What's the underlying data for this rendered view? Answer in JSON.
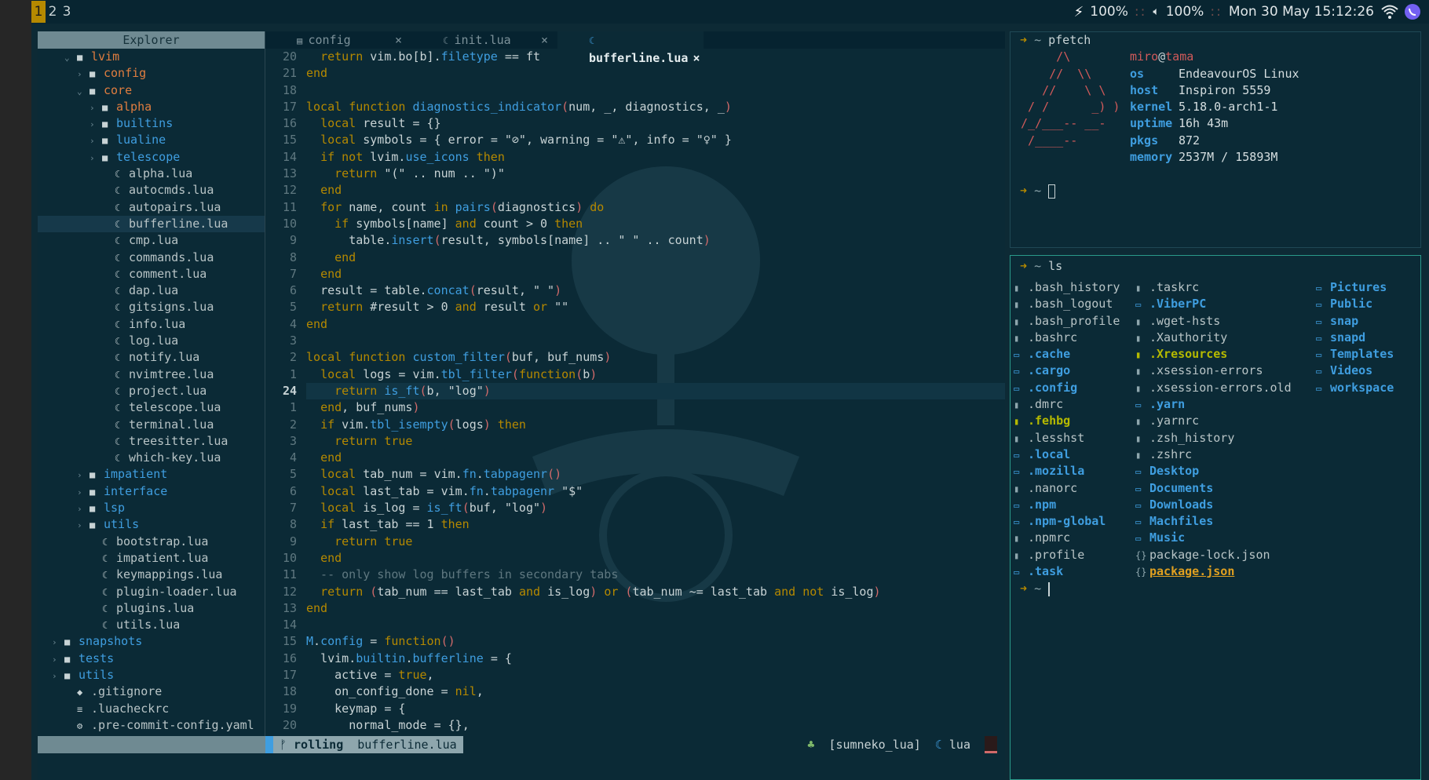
{
  "topbar": {
    "workspaces": [
      "1",
      "2",
      "3"
    ],
    "active_workspace": "1",
    "battery": "100%",
    "volume": "100%",
    "datetime": "Mon 30 May 15:12:26",
    "separator": "::"
  },
  "explorer": {
    "title": "Explorer",
    "items": [
      {
        "depth": 1,
        "arrow": "⌄",
        "type": "dir",
        "name": "lvim",
        "color": "orange"
      },
      {
        "depth": 2,
        "arrow": "›",
        "type": "dir",
        "name": "config",
        "color": "orange"
      },
      {
        "depth": 2,
        "arrow": "⌄",
        "type": "dir",
        "name": "core",
        "color": "orange"
      },
      {
        "depth": 3,
        "arrow": "›",
        "type": "dir",
        "name": "alpha",
        "color": "orange"
      },
      {
        "depth": 3,
        "arrow": "›",
        "type": "dir",
        "name": "builtins",
        "color": "blue"
      },
      {
        "depth": 3,
        "arrow": "›",
        "type": "dir",
        "name": "lualine",
        "color": "blue"
      },
      {
        "depth": 3,
        "arrow": "›",
        "type": "dir",
        "name": "telescope",
        "color": "blue"
      },
      {
        "depth": 4,
        "arrow": "",
        "type": "lua",
        "name": "alpha.lua"
      },
      {
        "depth": 4,
        "arrow": "",
        "type": "lua",
        "name": "autocmds.lua"
      },
      {
        "depth": 4,
        "arrow": "",
        "type": "lua",
        "name": "autopairs.lua"
      },
      {
        "depth": 4,
        "arrow": "",
        "type": "lua",
        "name": "bufferline.lua",
        "selected": true
      },
      {
        "depth": 4,
        "arrow": "",
        "type": "lua",
        "name": "cmp.lua"
      },
      {
        "depth": 4,
        "arrow": "",
        "type": "lua",
        "name": "commands.lua"
      },
      {
        "depth": 4,
        "arrow": "",
        "type": "lua",
        "name": "comment.lua"
      },
      {
        "depth": 4,
        "arrow": "",
        "type": "lua",
        "name": "dap.lua"
      },
      {
        "depth": 4,
        "arrow": "",
        "type": "lua",
        "name": "gitsigns.lua"
      },
      {
        "depth": 4,
        "arrow": "",
        "type": "lua",
        "name": "info.lua"
      },
      {
        "depth": 4,
        "arrow": "",
        "type": "lua",
        "name": "log.lua"
      },
      {
        "depth": 4,
        "arrow": "",
        "type": "lua",
        "name": "notify.lua"
      },
      {
        "depth": 4,
        "arrow": "",
        "type": "lua",
        "name": "nvimtree.lua"
      },
      {
        "depth": 4,
        "arrow": "",
        "type": "lua",
        "name": "project.lua"
      },
      {
        "depth": 4,
        "arrow": "",
        "type": "lua",
        "name": "telescope.lua"
      },
      {
        "depth": 4,
        "arrow": "",
        "type": "lua",
        "name": "terminal.lua"
      },
      {
        "depth": 4,
        "arrow": "",
        "type": "lua",
        "name": "treesitter.lua"
      },
      {
        "depth": 4,
        "arrow": "",
        "type": "lua",
        "name": "which-key.lua"
      },
      {
        "depth": 2,
        "arrow": "›",
        "type": "dir",
        "name": "impatient",
        "color": "blue"
      },
      {
        "depth": 2,
        "arrow": "›",
        "type": "dir",
        "name": "interface",
        "color": "blue"
      },
      {
        "depth": 2,
        "arrow": "›",
        "type": "dir",
        "name": "lsp",
        "color": "blue"
      },
      {
        "depth": 2,
        "arrow": "›",
        "type": "dir",
        "name": "utils",
        "color": "blue"
      },
      {
        "depth": 3,
        "arrow": "",
        "type": "lua",
        "name": "bootstrap.lua"
      },
      {
        "depth": 3,
        "arrow": "",
        "type": "lua",
        "name": "impatient.lua"
      },
      {
        "depth": 3,
        "arrow": "",
        "type": "lua",
        "name": "keymappings.lua"
      },
      {
        "depth": 3,
        "arrow": "",
        "type": "lua",
        "name": "plugin-loader.lua"
      },
      {
        "depth": 3,
        "arrow": "",
        "type": "lua",
        "name": "plugins.lua"
      },
      {
        "depth": 3,
        "arrow": "",
        "type": "lua",
        "name": "utils.lua"
      },
      {
        "depth": 0,
        "arrow": "›",
        "type": "dir",
        "name": "snapshots",
        "color": "blue"
      },
      {
        "depth": 0,
        "arrow": "›",
        "type": "dir",
        "name": "tests",
        "color": "blue"
      },
      {
        "depth": 0,
        "arrow": "›",
        "type": "dir",
        "name": "utils",
        "color": "blue"
      },
      {
        "depth": 1,
        "arrow": "",
        "type": "git",
        "name": ".gitignore"
      },
      {
        "depth": 1,
        "arrow": "",
        "type": "text",
        "name": ".luacheckrc"
      },
      {
        "depth": 1,
        "arrow": "",
        "type": "gear",
        "name": ".pre-commit-config.yaml"
      }
    ]
  },
  "tabs": [
    {
      "label": "config",
      "icon": "file",
      "close": "×",
      "active": false
    },
    {
      "label": "init.lua",
      "icon": "lua",
      "close": "×",
      "active": false
    },
    {
      "label": "bufferline.lua",
      "icon": "lua",
      "close": "×",
      "active": true
    }
  ],
  "editor": {
    "line_numbers": [
      "20",
      "21",
      "18",
      "17",
      "16",
      "15",
      "14",
      "13",
      "12",
      "11",
      "10",
      "9",
      "8",
      "7",
      "6",
      "5",
      "4",
      "3",
      "2",
      "1",
      "24",
      "1",
      "2",
      "3",
      "4",
      "5",
      "6",
      "7",
      "8",
      "9",
      "10",
      "11",
      "12",
      "13",
      "14",
      "15",
      "16",
      "17",
      "18",
      "19",
      "20"
    ],
    "current_line_index": 20,
    "lines": [
      "  return vim.bo[b].filetype == ft",
      "end",
      "",
      "local function diagnostics_indicator(num, _, diagnostics, _)",
      "  local result = {}",
      "  local symbols = { error = \"⊘\", warning = \"⚠\", info = \"♀\" }",
      "  if not lvim.use_icons then",
      "    return \"(\" .. num .. \")\"",
      "  end",
      "  for name, count in pairs(diagnostics) do",
      "    if symbols[name] and count > 0 then",
      "      table.insert(result, symbols[name] .. \" \" .. count)",
      "    end",
      "  end",
      "  result = table.concat(result, \" \")",
      "  return #result > 0 and result or \"\"",
      "end",
      "",
      "local function custom_filter(buf, buf_nums)",
      "  local logs = vim.tbl_filter(function(b)",
      "    return is_ft(b, \"log\")",
      "  end, buf_nums)",
      "  if vim.tbl_isempty(logs) then",
      "    return true",
      "  end",
      "  local tab_num = vim.fn.tabpagenr()",
      "  local last_tab = vim.fn.tabpagenr \"$\"",
      "  local is_log = is_ft(buf, \"log\")",
      "  if last_tab == 1 then",
      "    return true",
      "  end",
      "  -- only show log buffers in secondary tabs",
      "  return (tab_num == last_tab and is_log) or (tab_num ~= last_tab and not is_log)",
      "end",
      "",
      "M.config = function()",
      "  lvim.builtin.bufferline = {",
      "    active = true,",
      "    on_config_done = nil,",
      "    keymap = {",
      "      normal_mode = {},"
    ]
  },
  "statusline": {
    "branch": "rolling",
    "file": "bufferline.lua",
    "lsp": "[sumneko_lua]",
    "filetype": "lua"
  },
  "term1": {
    "prompt": "~",
    "command": "pfetch",
    "user": "miro",
    "at": "@",
    "host": "tama",
    "art": [
      "      /\\",
      "     //  \\\\",
      "    //    \\ \\",
      "  / /      _) )",
      " /_/___-- __-",
      "  /____--"
    ],
    "fields": [
      {
        "key": "os",
        "value": "EndeavourOS Linux"
      },
      {
        "key": "host",
        "value": "Inspiron 5559"
      },
      {
        "key": "kernel",
        "value": "5.18.0-arch1-1"
      },
      {
        "key": "uptime",
        "value": "16h 43m"
      },
      {
        "key": "pkgs",
        "value": "872"
      },
      {
        "key": "memory",
        "value": "2537M / 15893M"
      }
    ],
    "prompt2": "~"
  },
  "term2": {
    "prompt": "~",
    "command": "ls",
    "prompt2": "~",
    "col1": [
      {
        "name": ".bash_history",
        "kind": "file"
      },
      {
        "name": ".bash_logout",
        "kind": "file"
      },
      {
        "name": ".bash_profile",
        "kind": "file"
      },
      {
        "name": ".bashrc",
        "kind": "file"
      },
      {
        "name": ".cache",
        "kind": "dir"
      },
      {
        "name": ".cargo",
        "kind": "dir"
      },
      {
        "name": ".config",
        "kind": "dir"
      },
      {
        "name": ".dmrc",
        "kind": "file"
      },
      {
        "name": ".fehbg",
        "kind": "exec"
      },
      {
        "name": ".lesshst",
        "kind": "file"
      },
      {
        "name": ".local",
        "kind": "dir"
      },
      {
        "name": ".mozilla",
        "kind": "dir"
      },
      {
        "name": ".nanorc",
        "kind": "file"
      },
      {
        "name": ".npm",
        "kind": "dir"
      },
      {
        "name": ".npm-global",
        "kind": "dir"
      },
      {
        "name": ".npmrc",
        "kind": "file"
      },
      {
        "name": ".profile",
        "kind": "file"
      },
      {
        "name": ".task",
        "kind": "dir"
      }
    ],
    "col2": [
      {
        "name": ".taskrc",
        "kind": "file"
      },
      {
        "name": ".ViberPC",
        "kind": "dir"
      },
      {
        "name": ".wget-hsts",
        "kind": "file"
      },
      {
        "name": ".Xauthority",
        "kind": "file"
      },
      {
        "name": ".Xresources",
        "kind": "exec"
      },
      {
        "name": ".xsession-errors",
        "kind": "file"
      },
      {
        "name": ".xsession-errors.old",
        "kind": "file"
      },
      {
        "name": ".yarn",
        "kind": "dir"
      },
      {
        "name": ".yarnrc",
        "kind": "file"
      },
      {
        "name": ".zsh_history",
        "kind": "file"
      },
      {
        "name": ".zshrc",
        "kind": "file"
      },
      {
        "name": "Desktop",
        "kind": "dir"
      },
      {
        "name": "Documents",
        "kind": "dir"
      },
      {
        "name": "Downloads",
        "kind": "dir"
      },
      {
        "name": "Machfiles",
        "kind": "dir"
      },
      {
        "name": "Music",
        "kind": "dir"
      },
      {
        "name": "package-lock.json",
        "kind": "json"
      },
      {
        "name": "package.json",
        "kind": "link"
      }
    ],
    "col3": [
      {
        "name": "Pictures",
        "kind": "dir"
      },
      {
        "name": "Public",
        "kind": "dir"
      },
      {
        "name": "snap",
        "kind": "dir"
      },
      {
        "name": "snapd",
        "kind": "dir"
      },
      {
        "name": "Templates",
        "kind": "dir"
      },
      {
        "name": "Videos",
        "kind": "dir"
      },
      {
        "name": "workspace",
        "kind": "dir"
      }
    ]
  }
}
